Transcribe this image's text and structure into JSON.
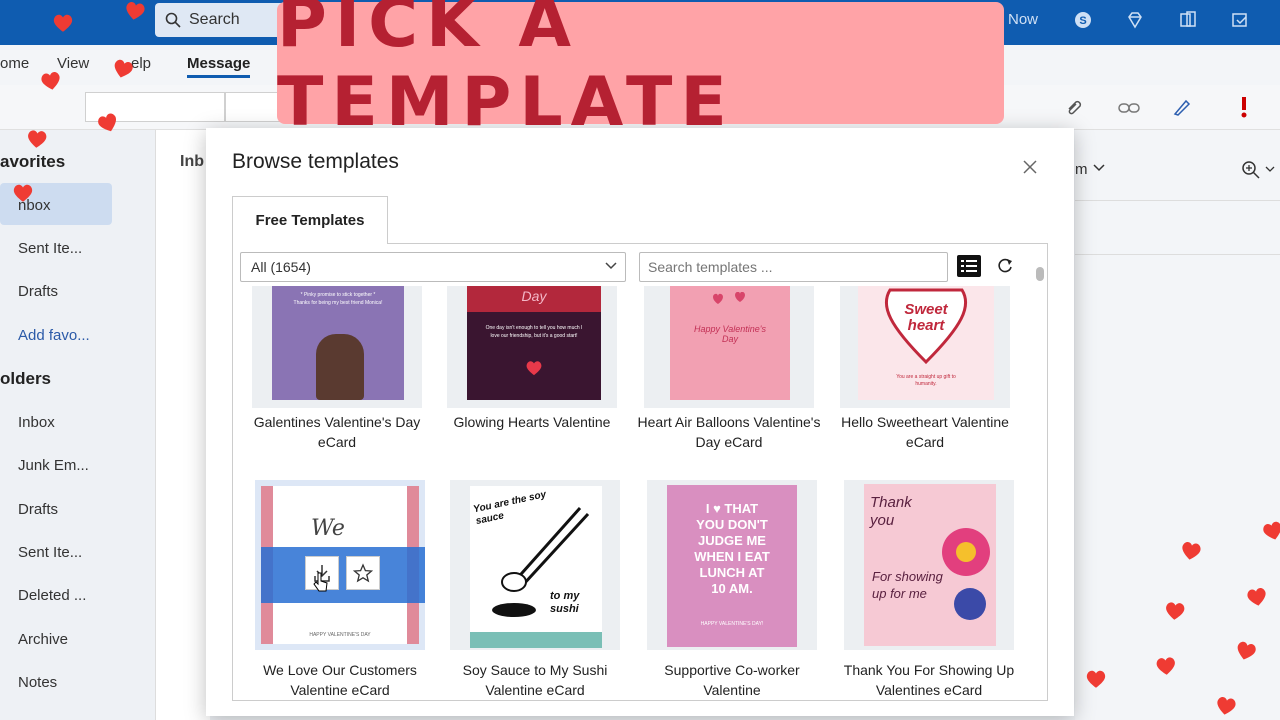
{
  "banner": {
    "text": "PICK A TEMPLATE"
  },
  "topbar": {
    "search_label": "Search",
    "now_label": "Now"
  },
  "ribbon": {
    "tabs": [
      {
        "label": "ome"
      },
      {
        "label": "View"
      },
      {
        "label": "elp"
      },
      {
        "label": "Message"
      }
    ]
  },
  "sidebar": {
    "favorites_header": "avorites",
    "favorites": [
      {
        "label": "nbox"
      },
      {
        "label": "Sent Ite..."
      },
      {
        "label": "Drafts"
      }
    ],
    "add_favorite": "Add favo...",
    "folders_header": "olders",
    "folders": [
      {
        "label": "Inbox"
      },
      {
        "label": "Junk Em..."
      },
      {
        "label": "Drafts"
      },
      {
        "label": "Sent Ite..."
      },
      {
        "label": "Deleted ..."
      },
      {
        "label": "Archive"
      },
      {
        "label": "Notes"
      }
    ]
  },
  "mid": {
    "inbox_label": "Inb"
  },
  "right": {
    "label": "m"
  },
  "modal": {
    "title": "Browse templates",
    "tab_label": "Free Templates",
    "filter_value": "All (1654)",
    "search_placeholder": "Search templates ...",
    "cards": [
      {
        "label_line1": "Galentines Valentine's Day",
        "label_line2": "eCard"
      },
      {
        "label_line1": "Glowing Hearts Valentine",
        "label_line2": ""
      },
      {
        "label_line1": "Heart Air Balloons Valentine's",
        "label_line2": "Day eCard"
      },
      {
        "label_line1": "Hello Sweetheart Valentine",
        "label_line2": "eCard"
      },
      {
        "label_line1": "We Love Our Customers",
        "label_line2": "Valentine eCard"
      },
      {
        "label_line1": "Soy Sauce to My Sushi",
        "label_line2": "Valentine eCard"
      },
      {
        "label_line1": "Supportive Co-worker",
        "label_line2": "Valentine"
      },
      {
        "label_line1": "Thank You For Showing Up",
        "label_line2": "Valentines eCard"
      }
    ],
    "thumb_text": {
      "galentines": "* Pinky promise to stick together *",
      "galentines2": "Thanks for being my best friend Monica!",
      "glowing_day": "Day",
      "glowing_msg": "One day isn't enough to tell you how much I love our friendship, but it's a good start!",
      "balloons": "Happy Valentine's Day",
      "sweet": "Sweet heart",
      "sweet_msg": "You are a straight up gift to humanity.",
      "customers_we": "We",
      "customers_footer": "HAPPY VALENTINE'S DAY",
      "soy_top": "You are the soy sauce",
      "soy_bottom": "to my sushi",
      "cowork_l1": "I ♥ THAT",
      "cowork_l2": "YOU DON'T",
      "cowork_l3": "JUDGE ME",
      "cowork_l4": "WHEN I EAT",
      "cowork_l5": "LUNCH AT",
      "cowork_l6": "10 AM.",
      "cowork_footer": "HAPPY VALENTINE'S DAY!",
      "thanks_top": "Thank you",
      "thanks_bottom": "For showing up for me"
    }
  },
  "colors": {
    "accent": "#0f5cb0",
    "banner_bg": "#ffa3a7",
    "banner_text": "#b52132",
    "heart": "#ef3b33"
  }
}
